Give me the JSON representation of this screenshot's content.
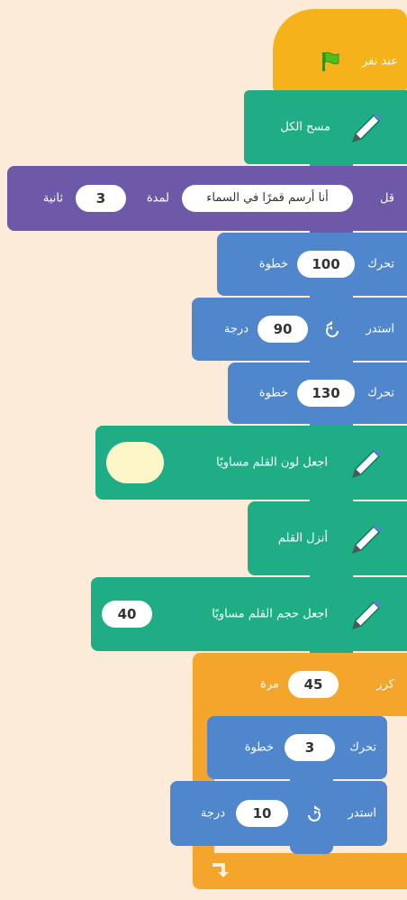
{
  "colors": {
    "background": "#fcebd8",
    "events": "#f6b21b",
    "pen": "#1fad86",
    "looks": "#6d59a8",
    "motion": "#4f86cc",
    "control": "#f4a52c",
    "pen_color_swatch": "#fdf6c8"
  },
  "script": {
    "hat": {
      "label": "عند نقر",
      "icon": "green-flag-icon"
    },
    "clear": {
      "label": "مسح الكل",
      "icon": "pen-icon"
    },
    "say": {
      "label": "قل",
      "text": "أنا أرسم قمرًا في السماء",
      "for_label": "لمدة",
      "seconds": "3",
      "seconds_label": "ثانية"
    },
    "move1": {
      "label": "تحرك",
      "steps": "100",
      "unit": "خطوة"
    },
    "turn_left": {
      "label": "استدر",
      "degrees": "90",
      "unit": "درجة",
      "icon": "rotate-left-icon"
    },
    "move2": {
      "label": "تحرك",
      "steps": "130",
      "unit": "خطوة"
    },
    "set_color": {
      "label": "اجعل لون القلم مساويًا",
      "icon": "pen-icon"
    },
    "pen_down": {
      "label": "أنزل القلم",
      "icon": "pen-icon"
    },
    "set_size": {
      "label": "اجعل حجم القلم مساويًا",
      "value": "40",
      "icon": "pen-icon"
    },
    "repeat": {
      "label": "كرر",
      "times": "45",
      "unit": "مرة",
      "icon": "loop-arrow-icon"
    },
    "move3": {
      "label": "تحرك",
      "steps": "3",
      "unit": "خطوة"
    },
    "turn_right": {
      "label": "استدر",
      "degrees": "10",
      "unit": "درجة",
      "icon": "rotate-right-icon"
    }
  }
}
